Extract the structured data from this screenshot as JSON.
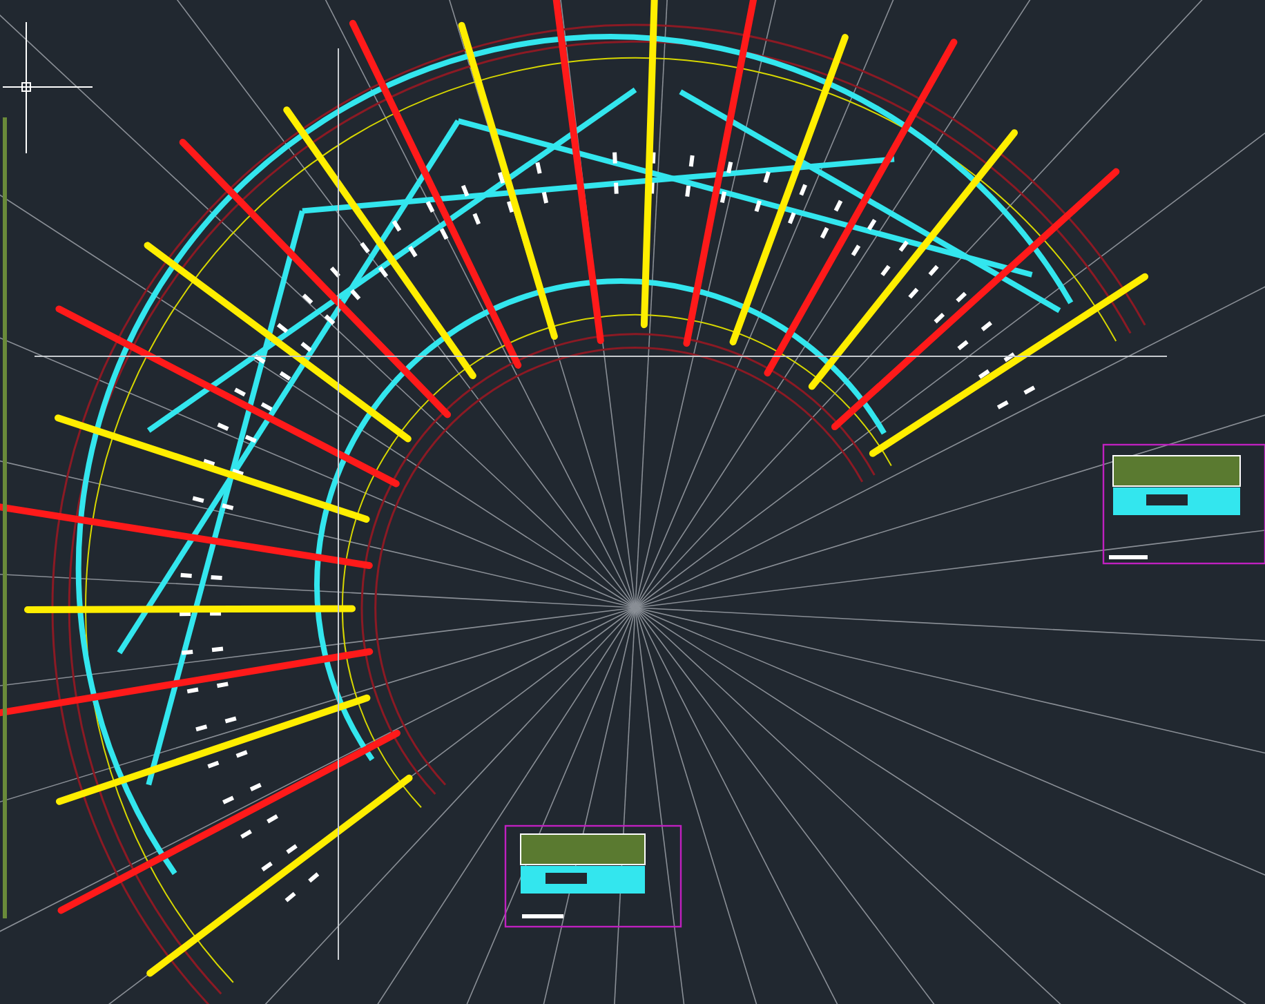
{
  "viewport": {
    "kind": "plan"
  }
}
